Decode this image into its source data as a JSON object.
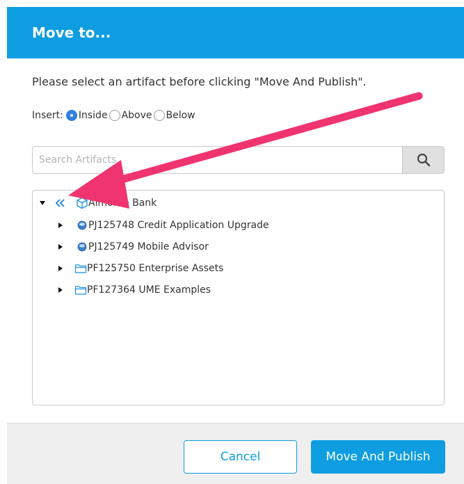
{
  "dialog": {
    "title": "Move to...",
    "instruction": "Please select an artifact before clicking \"Move And Publish\"."
  },
  "insert": {
    "label": "Insert:",
    "options": [
      {
        "label": "Inside",
        "selected": true
      },
      {
        "label": "Above",
        "selected": false
      },
      {
        "label": "Below",
        "selected": false
      }
    ]
  },
  "search": {
    "placeholder": "Search Artifacts",
    "value": "",
    "icon": "search-icon"
  },
  "tree": {
    "root": {
      "label": "Almonte Bank",
      "expanded": true,
      "icon": "cube-icon"
    },
    "children": [
      {
        "label": "PJ125748 Credit Application Upgrade",
        "icon": "project-icon",
        "expanded": false
      },
      {
        "label": "PJ125749 Mobile Advisor",
        "icon": "project-icon",
        "expanded": false
      },
      {
        "label": "PF125750 Enterprise Assets",
        "icon": "folder-icon",
        "expanded": false
      },
      {
        "label": "PF127364 UME Examples",
        "icon": "folder-icon",
        "expanded": false
      }
    ]
  },
  "footer": {
    "cancel_label": "Cancel",
    "primary_label": "Move And Publish"
  },
  "colors": {
    "brand": "#0d9de0",
    "radio_selected": "#2e7fe0",
    "annotation_arrow": "#f0346f"
  }
}
